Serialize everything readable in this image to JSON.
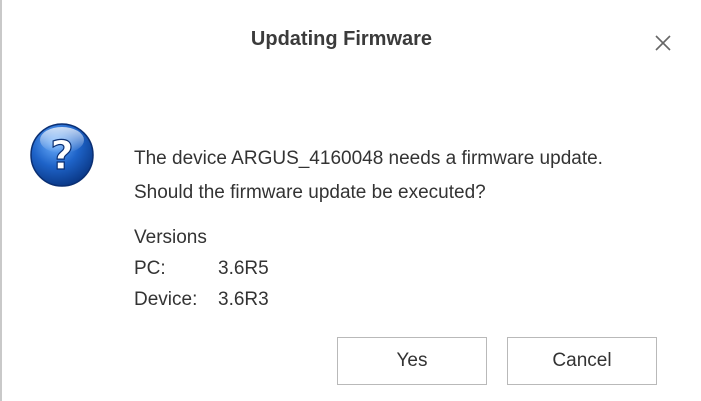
{
  "dialog": {
    "title": "Updating Firmware",
    "close_glyph": "close-icon",
    "icon": "question-icon",
    "message_line1": "The device ARGUS_4160048 needs a firmware update.",
    "message_line2": "Should the firmware update be executed?",
    "versions": {
      "heading": "Versions",
      "rows": [
        {
          "key": "PC:",
          "value": "3.6R5"
        },
        {
          "key": "Device:",
          "value": "3.6R3"
        }
      ]
    },
    "buttons": {
      "yes_label": "Yes",
      "cancel_label": "Cancel"
    }
  },
  "colors": {
    "icon_blue": "#1e63c8",
    "text": "#333333",
    "button_border": "#b9b9b9"
  }
}
